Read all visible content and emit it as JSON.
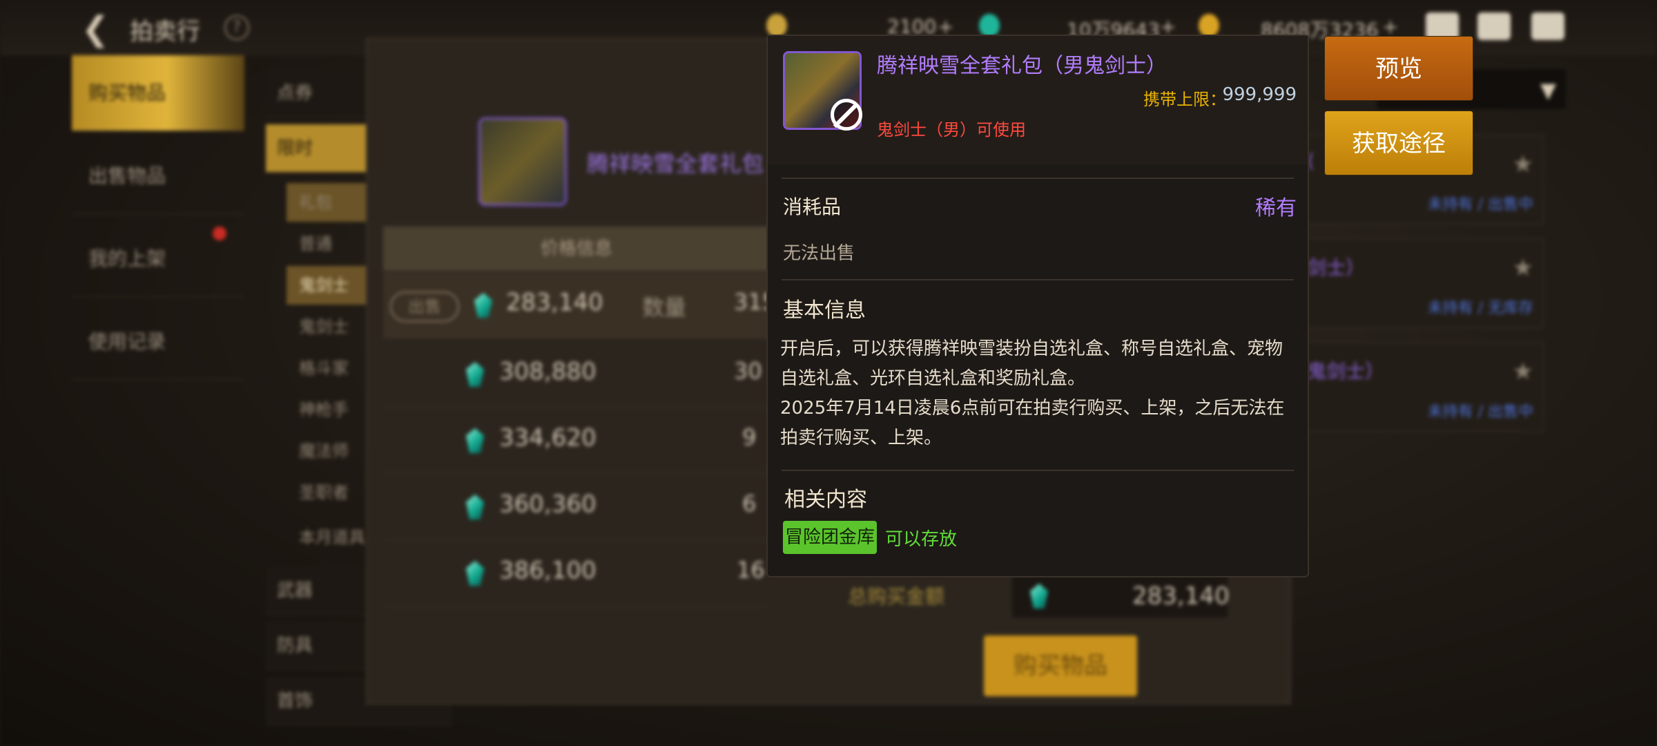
{
  "header": {
    "title": "拍卖行",
    "help_glyph": "?",
    "currency": [
      {
        "value": "2100",
        "icon": "moon-coin-icon",
        "color": "#c9a23b"
      },
      {
        "value": "10万9643",
        "icon": "gem-icon",
        "color": "#1fb59a"
      },
      {
        "value": "8608万3236",
        "icon": "gold-coin-icon",
        "color": "#d9a323"
      }
    ],
    "plus": "+"
  },
  "sidebar": {
    "items": [
      {
        "label": "购买物品",
        "active": true
      },
      {
        "label": "出售物品"
      },
      {
        "label": "我的上架"
      },
      {
        "label": "使用记录"
      }
    ]
  },
  "categories": {
    "items": [
      "点券",
      "限时",
      "武器",
      "防具",
      "首饰"
    ],
    "sub_items": [
      "礼包",
      "普通",
      "鬼剑士",
      "鬼剑士",
      "格斗家",
      "神枪手",
      "魔法师",
      "圣职者",
      "本月道具"
    ]
  },
  "listing": {
    "item_name": "腾祥映雪全套礼包（",
    "price_header": "价格信息",
    "sell_tag": "出售",
    "qty_label": "数量",
    "rows": [
      {
        "price": "283,140",
        "qty": "315"
      },
      {
        "price": "308,880",
        "qty": "30"
      },
      {
        "price": "334,620",
        "qty": "9"
      },
      {
        "price": "360,360",
        "qty": "6"
      },
      {
        "price": "386,100",
        "qty": "16"
      }
    ]
  },
  "purchase": {
    "total_label": "总购买金额",
    "total_value": "283,140",
    "buy_label": "购买物品"
  },
  "favorites": [
    {
      "name": "(",
      "status": "未持有 / 出售中"
    },
    {
      "name": "剑士）",
      "status": "未持有 / 无库存"
    },
    {
      "name": "鬼剑士）",
      "status": "未持有 / 出售中"
    }
  ],
  "tooltip": {
    "name": "腾祥映雪全套礼包（男鬼剑士）",
    "limit_label": "携带上限：",
    "limit_value": "999,999",
    "usable": "鬼剑士（男）可使用",
    "class": "消耗品",
    "rarity": "稀有",
    "no_sell": "无法出售",
    "basic_heading": "基本信息",
    "desc_1": "开启后，可以获得腾祥映雪装扮自选礼盒、称号自选礼盒、宠物自选礼盒、光环自选礼盒和奖励礼盒。",
    "desc_2": "2025年7月14日凌晨6点前可在拍卖行购买、上架，之后无法在拍卖行购买、上架。",
    "related_heading": "相关内容",
    "storage_tag": "冒险团金库",
    "storage_value": "可以存放",
    "rarity_color": "#b27dff"
  },
  "actions": {
    "preview": "预览",
    "source": "获取途径"
  }
}
